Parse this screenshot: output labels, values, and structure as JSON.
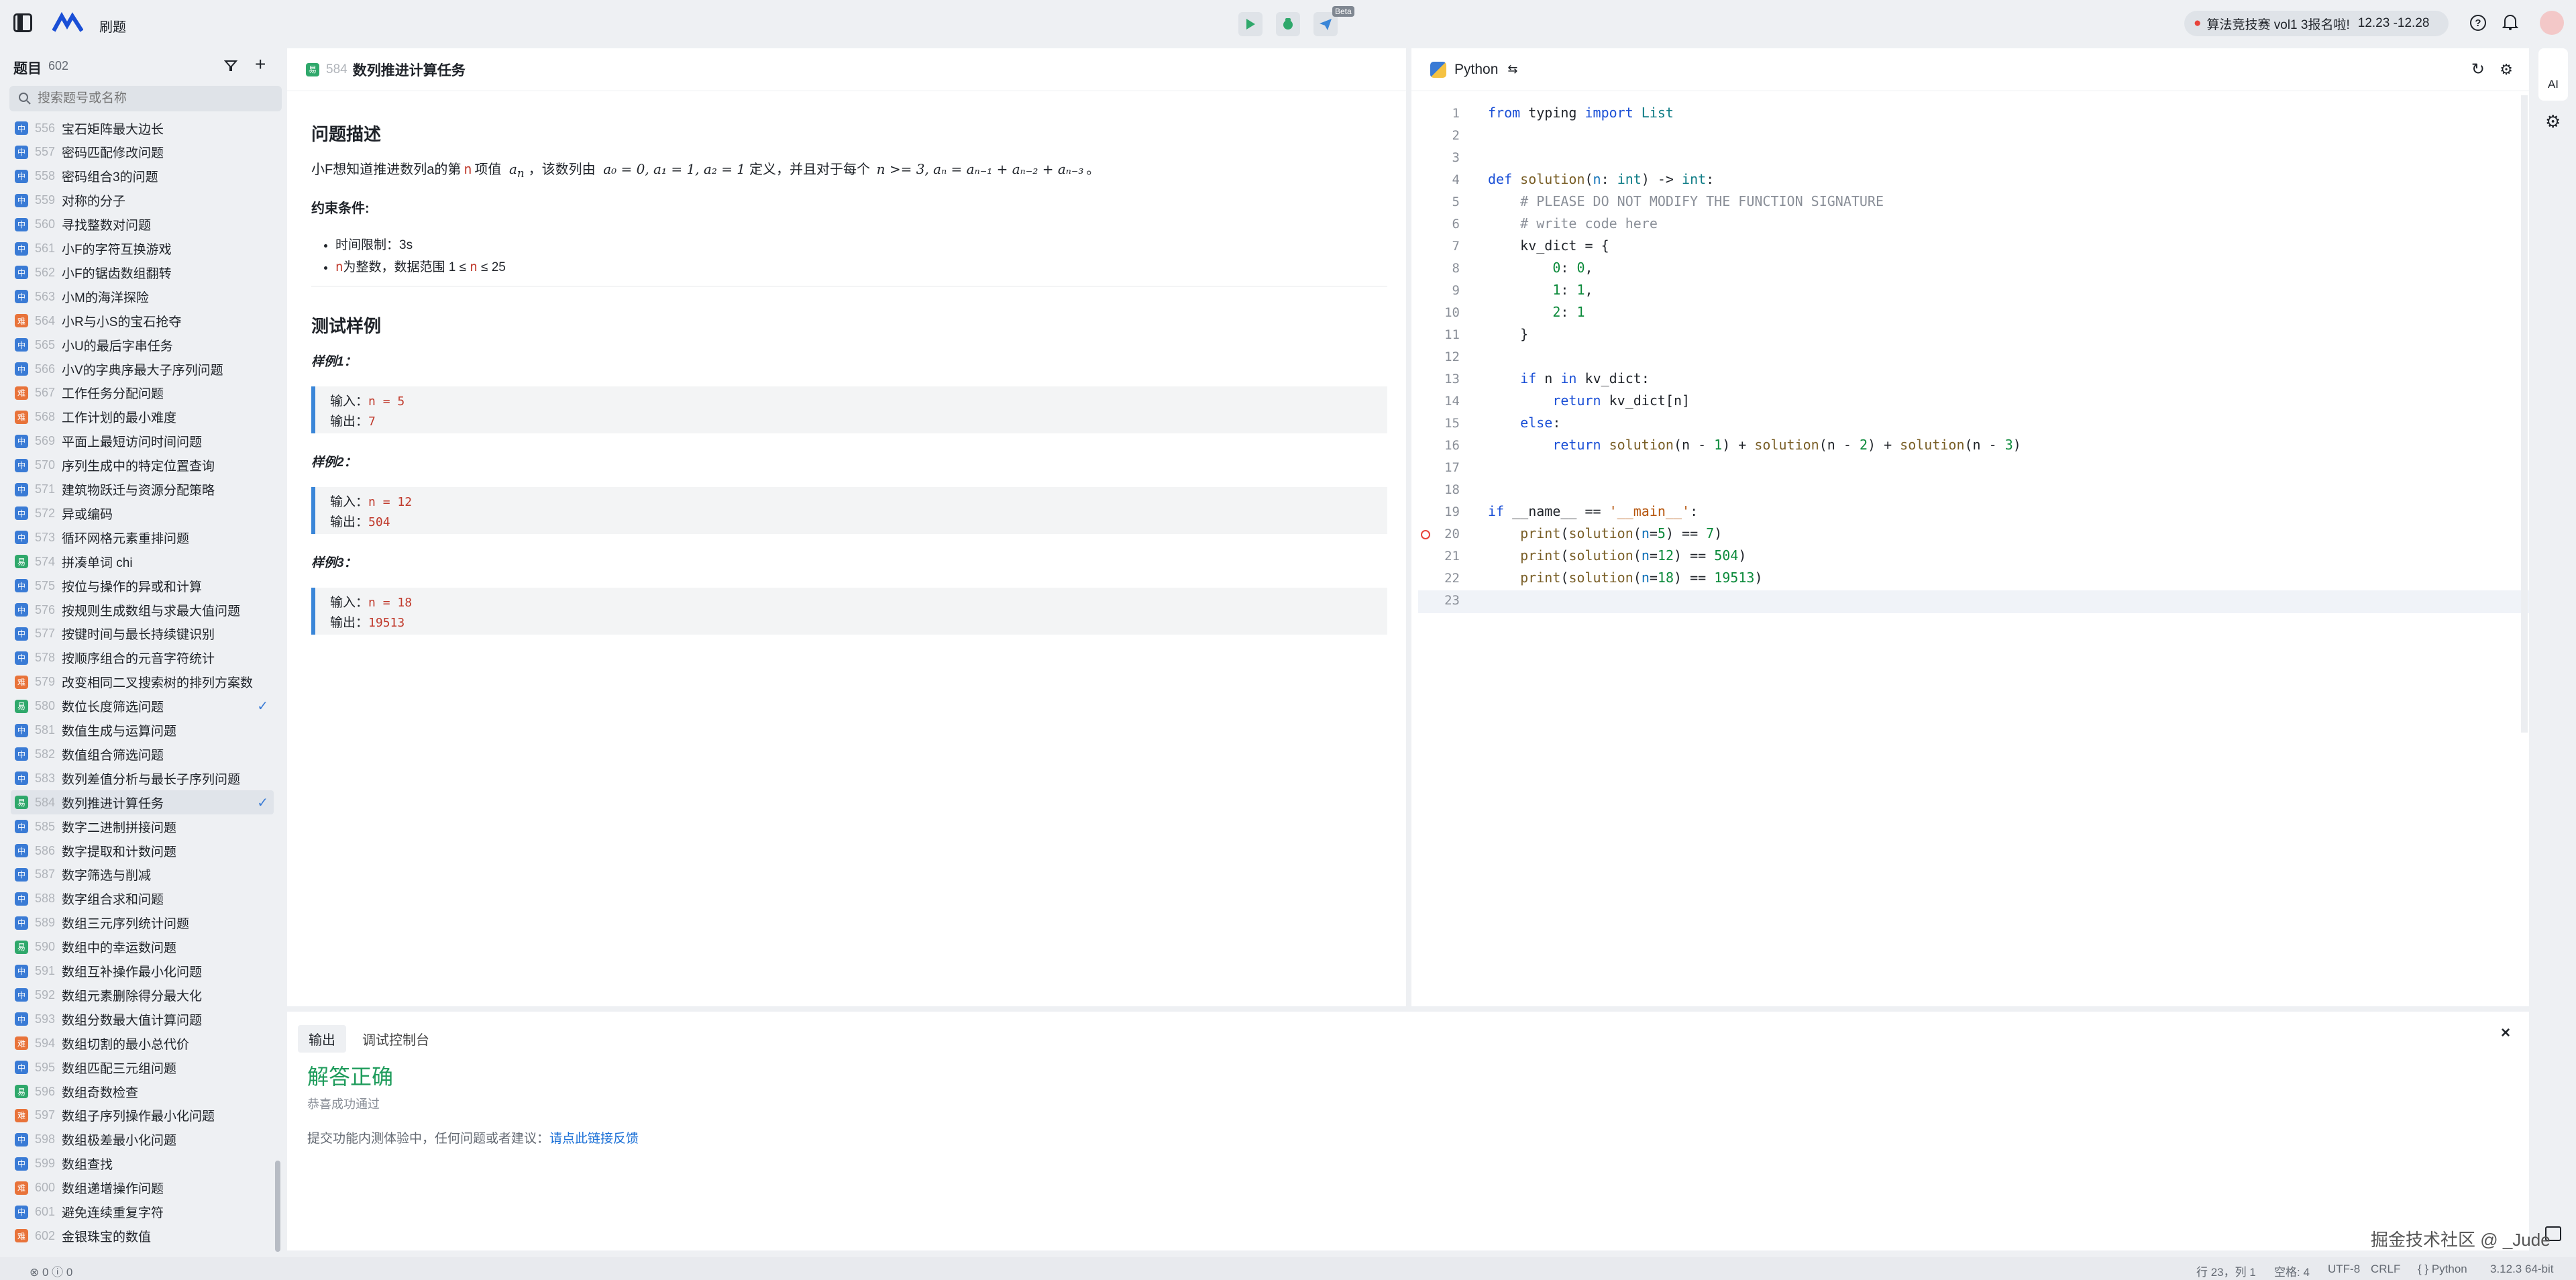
{
  "app": {
    "title": "刷题",
    "run_badge": "Beta",
    "contest_banner": "算法竞技赛 vol1 3报名啦!",
    "contest_dates": "12.23 -12.28"
  },
  "sidebar": {
    "title": "题目",
    "count": "602",
    "search_placeholder": "搜索题号或名称",
    "items": [
      {
        "num": "556",
        "title": "宝石矩阵最大边长",
        "diff": "中",
        "color": "#3a7bd5",
        "done": false
      },
      {
        "num": "557",
        "title": "密码匹配修改问题",
        "diff": "中",
        "color": "#3a7bd5",
        "done": false
      },
      {
        "num": "558",
        "title": "密码组合3的问题",
        "diff": "中",
        "color": "#3a7bd5",
        "done": false
      },
      {
        "num": "559",
        "title": "对称的分子",
        "diff": "中",
        "color": "#3a7bd5",
        "done": false
      },
      {
        "num": "560",
        "title": "寻找整数对问题",
        "diff": "中",
        "color": "#3a7bd5",
        "done": false
      },
      {
        "num": "561",
        "title": "小F的字符互换游戏",
        "diff": "中",
        "color": "#3a7bd5",
        "done": false
      },
      {
        "num": "562",
        "title": "小F的锯齿数组翻转",
        "diff": "中",
        "color": "#3a7bd5",
        "done": false
      },
      {
        "num": "563",
        "title": "小M的海洋探险",
        "diff": "中",
        "color": "#3a7bd5",
        "done": false
      },
      {
        "num": "564",
        "title": "小R与小S的宝石抢夺",
        "diff": "难",
        "color": "#e8733a",
        "done": false
      },
      {
        "num": "565",
        "title": "小U的最后字串任务",
        "diff": "中",
        "color": "#3a7bd5",
        "done": false
      },
      {
        "num": "566",
        "title": "小V的字典序最大子序列问题",
        "diff": "中",
        "color": "#3a7bd5",
        "done": false
      },
      {
        "num": "567",
        "title": "工作任务分配问题",
        "diff": "难",
        "color": "#e8733a",
        "done": false
      },
      {
        "num": "568",
        "title": "工作计划的最小难度",
        "diff": "难",
        "color": "#e8733a",
        "done": false
      },
      {
        "num": "569",
        "title": "平面上最短访问时间问题",
        "diff": "中",
        "color": "#3a7bd5",
        "done": false
      },
      {
        "num": "570",
        "title": "序列生成中的特定位置查询",
        "diff": "中",
        "color": "#3a7bd5",
        "done": false
      },
      {
        "num": "571",
        "title": "建筑物跃迁与资源分配策略",
        "diff": "中",
        "color": "#3a7bd5",
        "done": false
      },
      {
        "num": "572",
        "title": "异或编码",
        "diff": "中",
        "color": "#3a7bd5",
        "done": false
      },
      {
        "num": "573",
        "title": "循环网格元素重排问题",
        "diff": "中",
        "color": "#3a7bd5",
        "done": false
      },
      {
        "num": "574",
        "title": "拼凑单词 chi",
        "diff": "易",
        "color": "#2fa86b",
        "done": false
      },
      {
        "num": "575",
        "title": "按位与操作的异或和计算",
        "diff": "中",
        "color": "#3a7bd5",
        "done": false
      },
      {
        "num": "576",
        "title": "按规则生成数组与求最大值问题",
        "diff": "中",
        "color": "#3a7bd5",
        "done": false
      },
      {
        "num": "577",
        "title": "按键时间与最长持续键识别",
        "diff": "中",
        "color": "#3a7bd5",
        "done": false
      },
      {
        "num": "578",
        "title": "按顺序组合的元音字符统计",
        "diff": "中",
        "color": "#3a7bd5",
        "done": false
      },
      {
        "num": "579",
        "title": "改变相同二叉搜索树的排列方案数",
        "diff": "难",
        "color": "#e8733a",
        "done": false
      },
      {
        "num": "580",
        "title": "数位长度筛选问题",
        "diff": "易",
        "color": "#2fa86b",
        "done": true
      },
      {
        "num": "581",
        "title": "数值生成与运算问题",
        "diff": "中",
        "color": "#3a7bd5",
        "done": false
      },
      {
        "num": "582",
        "title": "数值组合筛选问题",
        "diff": "中",
        "color": "#3a7bd5",
        "done": false
      },
      {
        "num": "583",
        "title": "数列差值分析与最长子序列问题",
        "diff": "中",
        "color": "#3a7bd5",
        "done": false
      },
      {
        "num": "584",
        "title": "数列推进计算任务",
        "diff": "易",
        "color": "#2fa86b",
        "done": true
      },
      {
        "num": "585",
        "title": "数字二进制拼接问题",
        "diff": "中",
        "color": "#3a7bd5",
        "done": false
      },
      {
        "num": "586",
        "title": "数字提取和计数问题",
        "diff": "中",
        "color": "#3a7bd5",
        "done": false
      },
      {
        "num": "587",
        "title": "数字筛选与削减",
        "diff": "中",
        "color": "#3a7bd5",
        "done": false
      },
      {
        "num": "588",
        "title": "数字组合求和问题",
        "diff": "中",
        "color": "#3a7bd5",
        "done": false
      },
      {
        "num": "589",
        "title": "数组三元序列统计问题",
        "diff": "中",
        "color": "#3a7bd5",
        "done": false
      },
      {
        "num": "590",
        "title": "数组中的幸运数问题",
        "diff": "易",
        "color": "#2fa86b",
        "done": false
      },
      {
        "num": "591",
        "title": "数组互补操作最小化问题",
        "diff": "中",
        "color": "#3a7bd5",
        "done": false
      },
      {
        "num": "592",
        "title": "数组元素删除得分最大化",
        "diff": "中",
        "color": "#3a7bd5",
        "done": false
      },
      {
        "num": "593",
        "title": "数组分数最大值计算问题",
        "diff": "中",
        "color": "#3a7bd5",
        "done": false
      },
      {
        "num": "594",
        "title": "数组切割的最小总代价",
        "diff": "难",
        "color": "#e8733a",
        "done": false
      },
      {
        "num": "595",
        "title": "数组匹配三元组问题",
        "diff": "中",
        "color": "#3a7bd5",
        "done": false
      },
      {
        "num": "596",
        "title": "数组奇数检查",
        "diff": "易",
        "color": "#2fa86b",
        "done": false
      },
      {
        "num": "597",
        "title": "数组子序列操作最小化问题",
        "diff": "难",
        "color": "#e8733a",
        "done": false
      },
      {
        "num": "598",
        "title": "数组极差最小化问题",
        "diff": "中",
        "color": "#3a7bd5",
        "done": false
      },
      {
        "num": "599",
        "title": "数组查找",
        "diff": "中",
        "color": "#3a7bd5",
        "done": false
      },
      {
        "num": "600",
        "title": "数组递增操作问题",
        "diff": "难",
        "color": "#e8733a",
        "done": false
      },
      {
        "num": "601",
        "title": "避免连续重复字符",
        "diff": "中",
        "color": "#3a7bd5",
        "done": false
      },
      {
        "num": "602",
        "title": "金银珠宝的数值",
        "diff": "难",
        "color": "#e8733a",
        "done": false
      }
    ]
  },
  "problem": {
    "badge": "易",
    "num": "584",
    "title": "数列推进计算任务",
    "desc_heading": "问题描述",
    "desc_a": "小F想知道推进数列a的第",
    "desc_n": "n",
    "desc_b": "项值",
    "desc_c": "，该数列由",
    "desc_d": "定义，并且对于每个",
    "desc_e": "。",
    "math_an": "a",
    "math_an_sub": "n",
    "math_init": "a₀ = 0, a₁ = 1, a₂ = 1",
    "math_rec": "n >= 3, aₙ = aₙ₋₁ + aₙ₋₂ + aₙ₋₃",
    "constraints_heading": "约束条件:",
    "c1": "时间限制：3s",
    "c2_n": "n",
    "c2_a": "为整数，数据范围 1 ≤",
    "c2_b": "≤ 25",
    "samples_heading": "测试样例",
    "samples": [
      {
        "label": "样例1：",
        "in_label": "输入：",
        "in": "n = 5",
        "out_label": "输出：",
        "out": "7"
      },
      {
        "label": "样例2：",
        "in_label": "输入：",
        "in": "n = 12",
        "out_label": "输出：",
        "out": "504"
      },
      {
        "label": "样例3：",
        "in_label": "输入：",
        "in": "n = 18",
        "out_label": "输出：",
        "out": "19513"
      }
    ]
  },
  "editor": {
    "language": "Python"
  },
  "output": {
    "tab_output": "输出",
    "tab_console": "调试控制台",
    "result": "解答正确",
    "result_sub": "恭喜成功通过",
    "feedback": "提交功能内测体验中，任何问题或者建议：",
    "feedback_link": "请点此链接反馈"
  },
  "status": {
    "problems": "0",
    "warnings": "0",
    "position": "行 23，列 1",
    "spaces": "空格: 4",
    "encoding": "UTF-8",
    "eol": "CRLF",
    "lang": "Python",
    "version": "3.12.3 64-bit"
  },
  "ai_label": "AI",
  "watermark": "掘金技术社区 @ _Jude"
}
